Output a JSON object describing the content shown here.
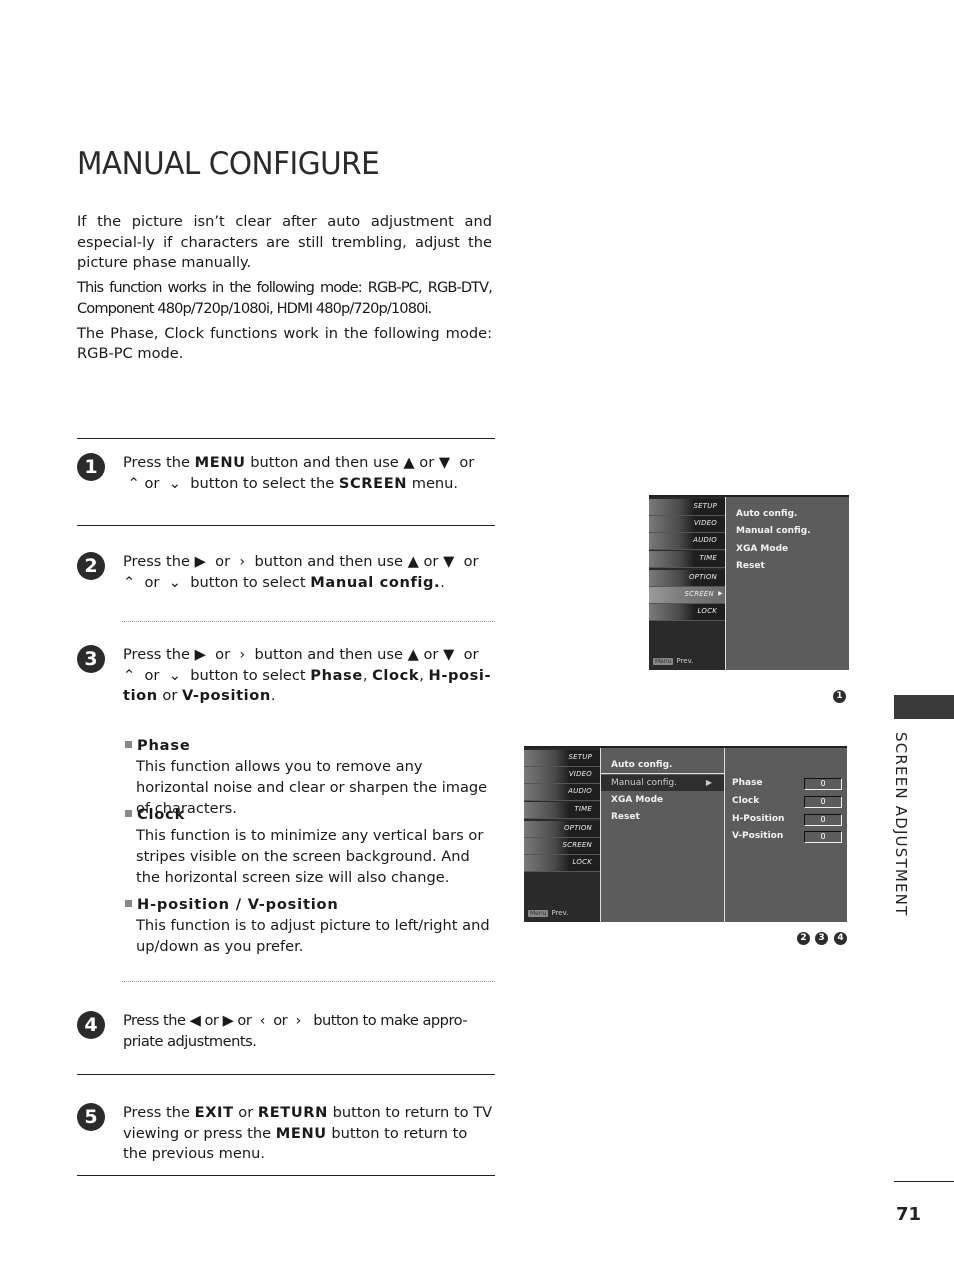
{
  "title": "MANUAL CONFIGURE",
  "intro": [
    "If the picture isn’t clear after auto adjustment and especial-ly if characters are still trembling, adjust the picture phase manually.",
    "This function works in the following mode: RGB-PC, RGB-DTV, Component 480p/720p/1080i, HDMI 480p/720p/1080i.",
    "The Phase, Clock functions work in the following mode: RGB-PC mode."
  ],
  "steps": [
    {
      "num": "1",
      "text": "Press the <b>MENU</b> button and then use ▲ or ▼&nbsp; or &nbsp;⌃ or &nbsp;⌄&nbsp; button to select the <b>SCREEN</b> menu."
    },
    {
      "num": "2",
      "text": "Press the ▶&nbsp; or &nbsp;›&nbsp; button and then use ▲ or ▼&nbsp; or ⌃&nbsp; or &nbsp;⌄&nbsp; button to select <b>Manual config.</b>."
    },
    {
      "num": "3",
      "text": "Press the ▶&nbsp; or &nbsp;›&nbsp; button and then use ▲ or ▼&nbsp; or ⌃&nbsp; or &nbsp;⌄&nbsp; button to select <b>Phase</b>, <b>Clock</b>, <b>H-posi-tion</b> or <b>V-position</b>."
    },
    {
      "num": "4",
      "text": "Press the ◀ or ▶ or &nbsp;‹&nbsp; or &nbsp;›&nbsp;&nbsp; button to make appro-priate adjustments."
    },
    {
      "num": "5",
      "text": "Press the <b>EXIT</b> or <b>RETURN</b> button to return to TV viewing or press the <b>MENU</b> button to return to the previous menu."
    }
  ],
  "bullets": [
    {
      "head": "Phase",
      "body": "This function allows you to remove any horizontal noise and clear or sharpen the image of characters."
    },
    {
      "head": "Clock",
      "body": "This function is to minimize any vertical bars or stripes visible on the screen background. And the horizontal screen size will also change."
    },
    {
      "head": "H-position / V-position",
      "body": "This function is to adjust picture to left/right and up/down as you prefer."
    }
  ],
  "osd": {
    "tabs": [
      "SETUP",
      "VIDEO",
      "AUDIO",
      "TIME",
      "OPTION",
      "SCREEN",
      "LOCK"
    ],
    "selected_tab": "SCREEN",
    "prev_key": "Menu",
    "prev_label": "Prev.",
    "screen_menu": [
      "Auto config.",
      "Manual config.",
      "XGA Mode",
      "Reset"
    ],
    "highlighted_item": "Manual config.",
    "adjustments": [
      {
        "label": "Phase",
        "value": "0"
      },
      {
        "label": "Clock",
        "value": "0"
      },
      {
        "label": "H-Position",
        "value": "0"
      },
      {
        "label": "V-Position",
        "value": "0"
      }
    ]
  },
  "figure_badges": {
    "first": [
      "1"
    ],
    "second": [
      "2",
      "3",
      "4"
    ]
  },
  "side_label": "SCREEN ADJUSTMENT",
  "page_number": "71"
}
